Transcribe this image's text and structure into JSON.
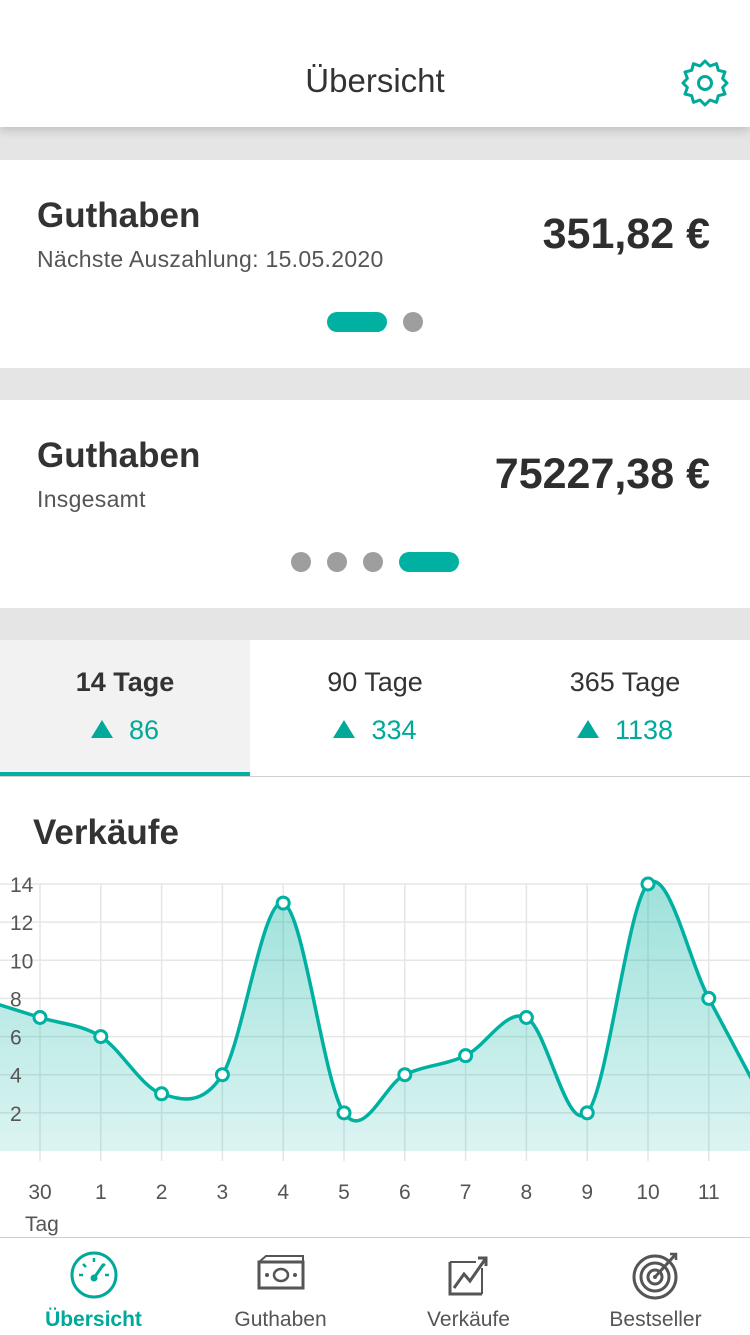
{
  "header": {
    "title": "Übersicht",
    "settings_icon": "gear-icon"
  },
  "cards": [
    {
      "title": "Guthaben",
      "subtitle": "Nächste Auszahlung: 15.05.2020",
      "amount": "351,82 €",
      "pages": 2,
      "active_page": 0
    },
    {
      "title": "Guthaben",
      "subtitle": "Insgesamt",
      "amount": "75227,38 €",
      "pages": 4,
      "active_page": 3
    }
  ],
  "period_tabs": [
    {
      "label": "14 Tage",
      "value": "86",
      "selected": true
    },
    {
      "label": "90 Tage",
      "value": "334",
      "selected": false
    },
    {
      "label": "365 Tage",
      "value": "1138",
      "selected": false
    }
  ],
  "sales": {
    "title": "Verkäufe"
  },
  "chart_data": {
    "type": "area",
    "title": "Verkäufe",
    "xlabel": "Tag",
    "ylabel": "",
    "categories": [
      "30",
      "1",
      "2",
      "3",
      "4",
      "5",
      "6",
      "7",
      "8",
      "9",
      "10",
      "11"
    ],
    "values": [
      7,
      6,
      3,
      4,
      13,
      2,
      4,
      5,
      7,
      2,
      14,
      8
    ],
    "y_ticks": [
      "2",
      "4",
      "6",
      "8",
      "10",
      "12",
      "14"
    ],
    "ylim": [
      0,
      14
    ],
    "grid": true,
    "color": "#00b0a0"
  },
  "tabbar": [
    {
      "label": "Übersicht",
      "icon": "speedometer-icon",
      "active": true
    },
    {
      "label": "Guthaben",
      "icon": "banknote-icon",
      "active": false
    },
    {
      "label": "Verkäufe",
      "icon": "trend-chart-icon",
      "active": false
    },
    {
      "label": "Bestseller",
      "icon": "target-icon",
      "active": false
    }
  ],
  "colors": {
    "accent": "#00b0a0",
    "accent_text": "#00a999",
    "background": "#e5e5e5",
    "dot_inactive": "#9e9e9e"
  }
}
